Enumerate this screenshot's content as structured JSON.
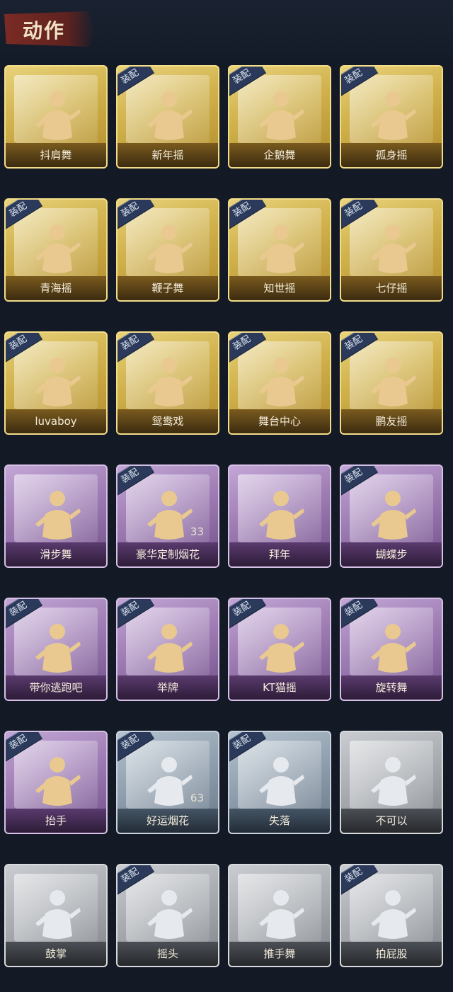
{
  "header": {
    "title": "动作"
  },
  "badge_label": "装配",
  "colors": {
    "gold": "#cfb04a",
    "purple": "#9a78b0",
    "blue": "#8d9cab",
    "gray": "#a5a9ae",
    "badge": "#2b3a5a"
  },
  "actions": [
    {
      "label": "抖肩舞",
      "tier": "gold",
      "equipped": false,
      "count": null
    },
    {
      "label": "新年摇",
      "tier": "gold",
      "equipped": true,
      "count": null
    },
    {
      "label": "企鹅舞",
      "tier": "gold",
      "equipped": true,
      "count": null
    },
    {
      "label": "孤身摇",
      "tier": "gold",
      "equipped": true,
      "count": null
    },
    {
      "label": "青海摇",
      "tier": "gold",
      "equipped": true,
      "count": null
    },
    {
      "label": "鞭子舞",
      "tier": "gold",
      "equipped": true,
      "count": null
    },
    {
      "label": "知世摇",
      "tier": "gold",
      "equipped": true,
      "count": null
    },
    {
      "label": "七仔摇",
      "tier": "gold",
      "equipped": true,
      "count": null
    },
    {
      "label": "luvaboy",
      "tier": "gold",
      "equipped": true,
      "count": null
    },
    {
      "label": "鸳鸯戏",
      "tier": "gold",
      "equipped": true,
      "count": null
    },
    {
      "label": "舞台中心",
      "tier": "gold",
      "equipped": true,
      "count": null
    },
    {
      "label": "鹏友摇",
      "tier": "gold",
      "equipped": true,
      "count": null
    },
    {
      "label": "滑步舞",
      "tier": "purple",
      "equipped": false,
      "count": null
    },
    {
      "label": "豪华定制烟花",
      "tier": "purple",
      "equipped": true,
      "count": "33"
    },
    {
      "label": "拜年",
      "tier": "purple",
      "equipped": false,
      "count": null
    },
    {
      "label": "蝴蝶步",
      "tier": "purple",
      "equipped": true,
      "count": null
    },
    {
      "label": "带你逃跑吧",
      "tier": "purple",
      "equipped": true,
      "count": null
    },
    {
      "label": "举牌",
      "tier": "purple",
      "equipped": true,
      "count": null
    },
    {
      "label": "KT猫摇",
      "tier": "purple",
      "equipped": true,
      "count": null
    },
    {
      "label": "旋转舞",
      "tier": "purple",
      "equipped": true,
      "count": null
    },
    {
      "label": "抬手",
      "tier": "purple",
      "equipped": true,
      "count": null
    },
    {
      "label": "好运烟花",
      "tier": "blue",
      "equipped": true,
      "count": "63"
    },
    {
      "label": "失落",
      "tier": "blue",
      "equipped": true,
      "count": null
    },
    {
      "label": "不可以",
      "tier": "gray",
      "equipped": false,
      "count": null
    },
    {
      "label": "鼓掌",
      "tier": "gray",
      "equipped": false,
      "count": null
    },
    {
      "label": "摇头",
      "tier": "gray",
      "equipped": true,
      "count": null
    },
    {
      "label": "推手舞",
      "tier": "gray",
      "equipped": false,
      "count": null
    },
    {
      "label": "拍屁股",
      "tier": "gray",
      "equipped": true,
      "count": null
    }
  ]
}
